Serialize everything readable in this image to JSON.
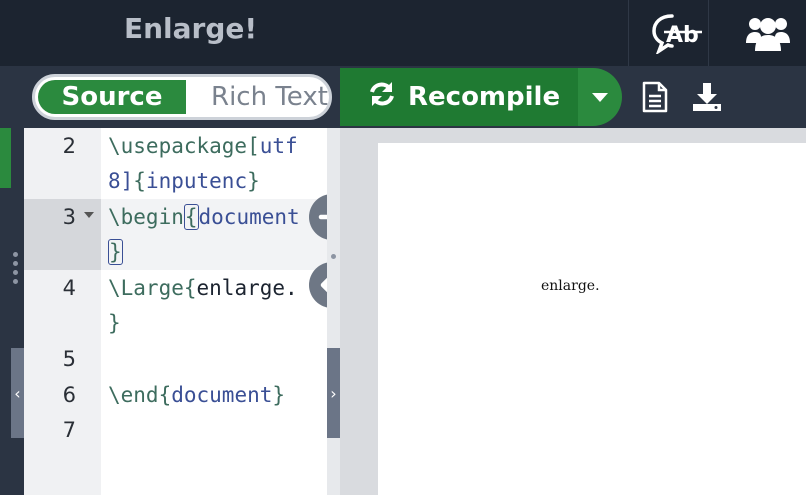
{
  "header": {
    "title": "Enlarge!",
    "icons": [
      "translate-ab-icon",
      "users-group-icon"
    ]
  },
  "toolbar": {
    "source_label": "Source",
    "richtext_label": "Rich Text",
    "recompile_label": "Recompile",
    "icons": [
      "refresh-icon",
      "caret-down-icon",
      "document-icon",
      "download-icon"
    ]
  },
  "editor": {
    "lines": [
      {
        "number": "2",
        "parts": [
          "\\usepackage",
          "[",
          "utf",
          "8]",
          "{",
          "inputenc",
          "}"
        ]
      },
      {
        "number": "3",
        "parts": [
          "\\begin",
          "{",
          "document",
          "}"
        ]
      },
      {
        "number": "4",
        "parts": [
          "\\Large",
          "{",
          "enlarge.",
          "}"
        ]
      },
      {
        "number": "5",
        "parts": []
      },
      {
        "number": "6",
        "parts": [
          "\\end",
          "{",
          "document",
          "}"
        ]
      },
      {
        "number": "7",
        "parts": []
      }
    ],
    "line_texts": {
      "l2a": "\\usepackage[utf",
      "l2b": "8]{inputenc}",
      "l3a": "\\begin{document",
      "l3b": "}",
      "l4a": "\\Large{enlarge.",
      "l4b": "}",
      "l6": "\\end{document}"
    }
  },
  "preview": {
    "text": "enlarge."
  },
  "colors": {
    "accent_green": "#2b8a3e",
    "recompile_green": "#1f7a32",
    "header_bg": "#1c2430",
    "toolbar_bg": "#2b3443"
  }
}
